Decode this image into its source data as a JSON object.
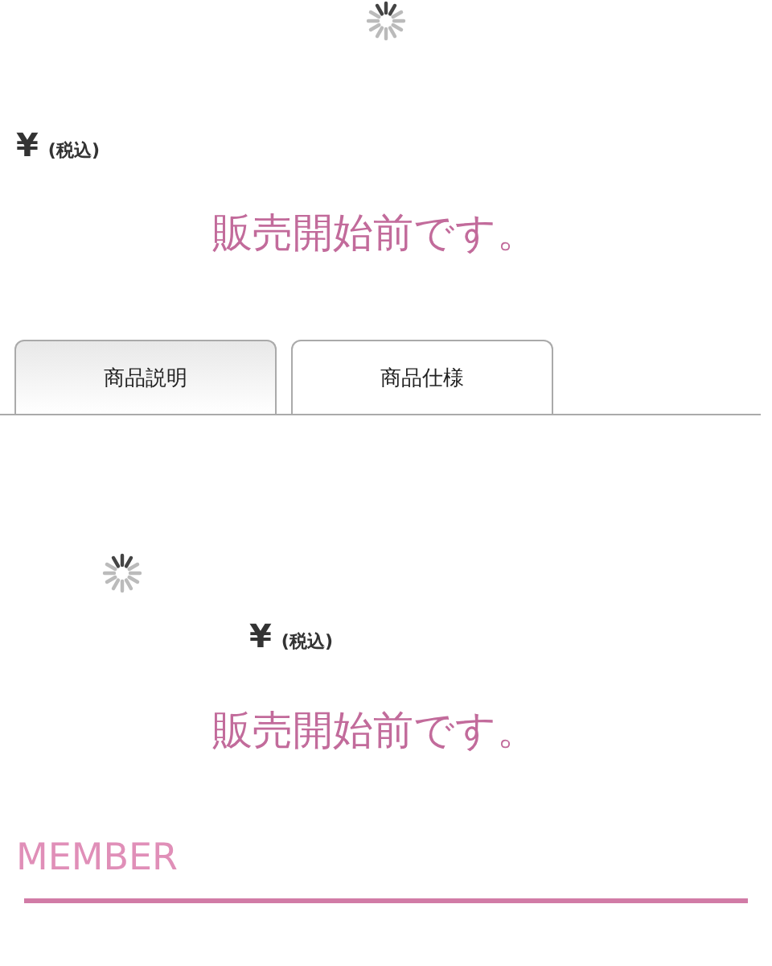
{
  "top_section": {
    "price": {
      "currency": "¥",
      "tax_note": "(税込)"
    },
    "sale_notice": "販売開始前です。"
  },
  "tabs": [
    {
      "label": "商品説明",
      "selected": true
    },
    {
      "label": "商品仕様",
      "selected": false
    }
  ],
  "tab_content": {
    "price": {
      "currency": "¥",
      "tax_note": "(税込)"
    },
    "sale_notice": "販売開始前です。"
  },
  "member_section": {
    "heading": "MEMBER"
  }
}
